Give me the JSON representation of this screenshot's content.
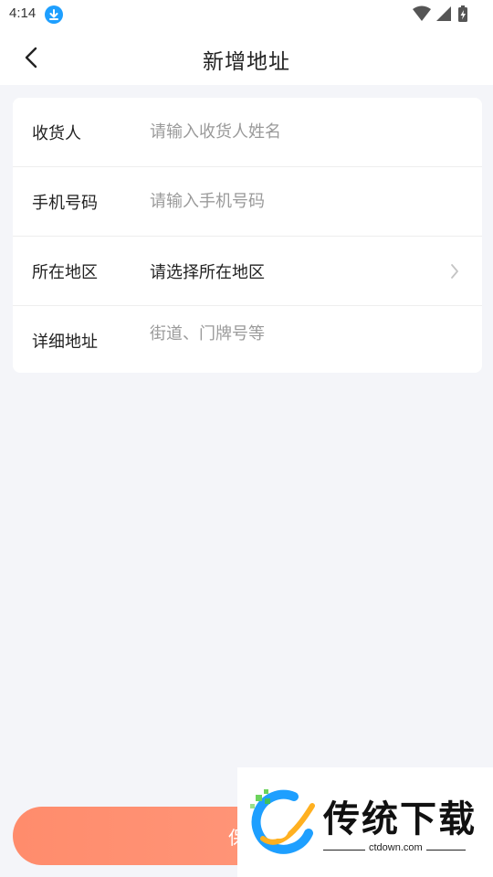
{
  "status_bar": {
    "time": "4:14",
    "download_icon": "download-icon",
    "wifi_icon": "wifi-icon",
    "signal_icon": "signal-icon",
    "battery_icon": "battery-charging-icon"
  },
  "header": {
    "title": "新增地址",
    "back_icon": "chevron-left-icon"
  },
  "form": {
    "consignee": {
      "label": "收货人",
      "placeholder": "请输入收货人姓名",
      "value": ""
    },
    "phone": {
      "label": "手机号码",
      "placeholder": "请输入手机号码",
      "value": ""
    },
    "region": {
      "label": "所在地区",
      "value": "请选择所在地区",
      "icon": "chevron-right-icon"
    },
    "address": {
      "label": "详细地址",
      "placeholder": "街道、门牌号等",
      "value": ""
    }
  },
  "save_button": {
    "label": "保"
  },
  "watermark": {
    "title": "传统下载",
    "url": "ctdown.com"
  },
  "colors": {
    "background": "#f4f5f9",
    "card": "#ffffff",
    "button_gradient_start": "#ff8c6c",
    "button_gradient_end": "#ff9c82",
    "placeholder": "#9a9a9a",
    "status_download_icon": "#1e9fff"
  }
}
